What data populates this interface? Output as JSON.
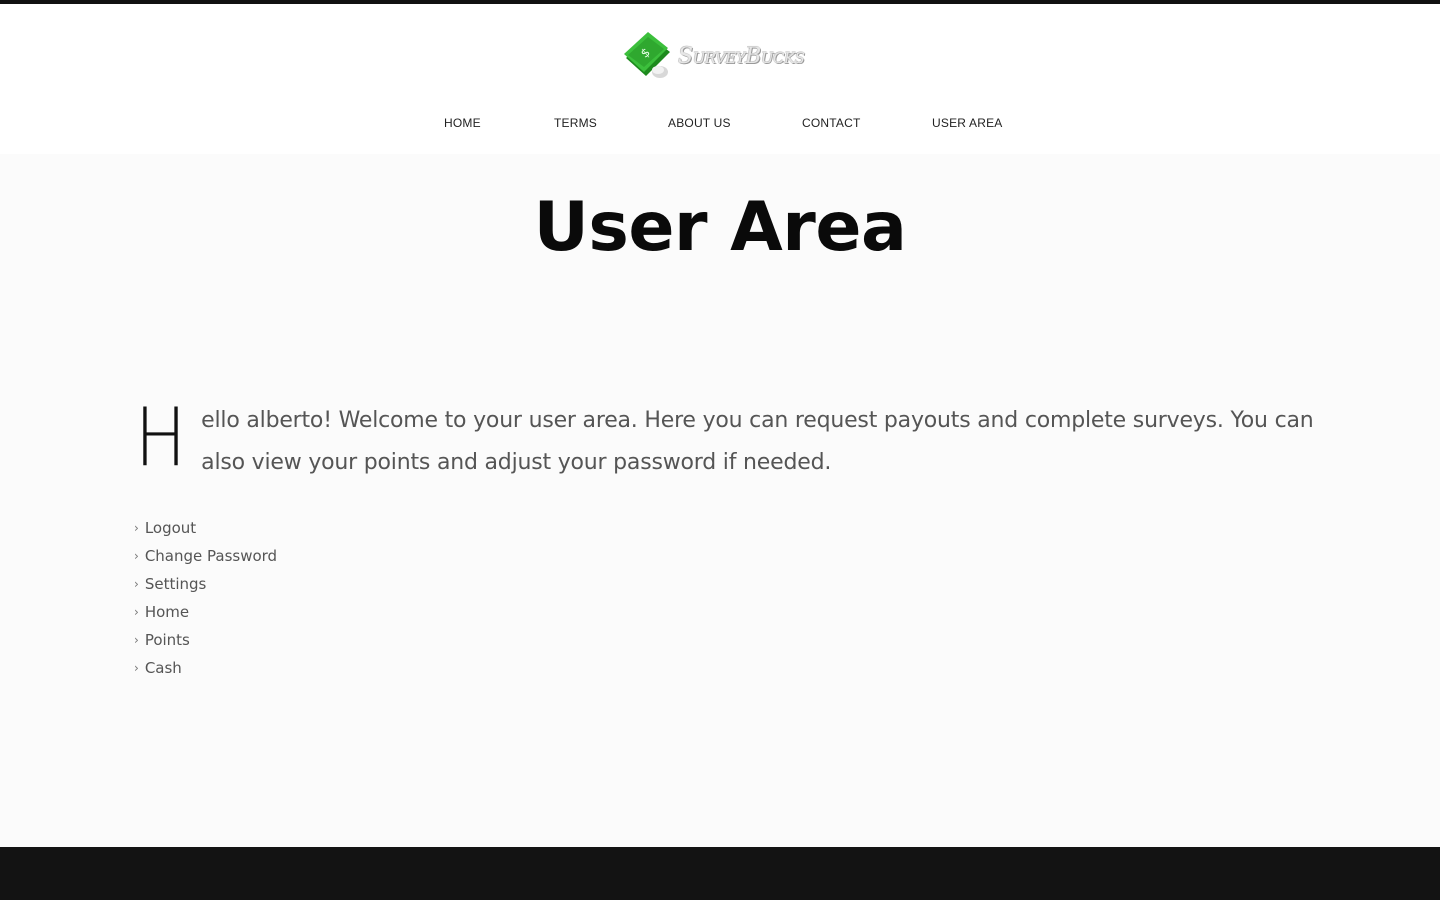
{
  "brand": {
    "name": "SurveyBucks",
    "accent": "#2fa82f"
  },
  "nav": {
    "items": [
      {
        "label": "HOME"
      },
      {
        "label": "TERMS"
      },
      {
        "label": "ABOUT US"
      },
      {
        "label": "CONTACT"
      },
      {
        "label": "USER AREA"
      }
    ]
  },
  "page": {
    "title": "User Area"
  },
  "intro": {
    "dropcap": "H",
    "text": "ello alberto! Welcome to your user area. Here you can request payouts and complete surveys. You can also view your points and adjust your password if needed."
  },
  "menu": {
    "arrow": "›",
    "items": [
      {
        "label": "Logout"
      },
      {
        "label": "Change Password"
      },
      {
        "label": "Settings"
      },
      {
        "label": "Home"
      },
      {
        "label": "Points"
      },
      {
        "label": "Cash"
      }
    ]
  },
  "colors": {
    "background": "#fbfbfb",
    "header": "#ffffff",
    "footer": "#131313",
    "text": "#555555"
  }
}
